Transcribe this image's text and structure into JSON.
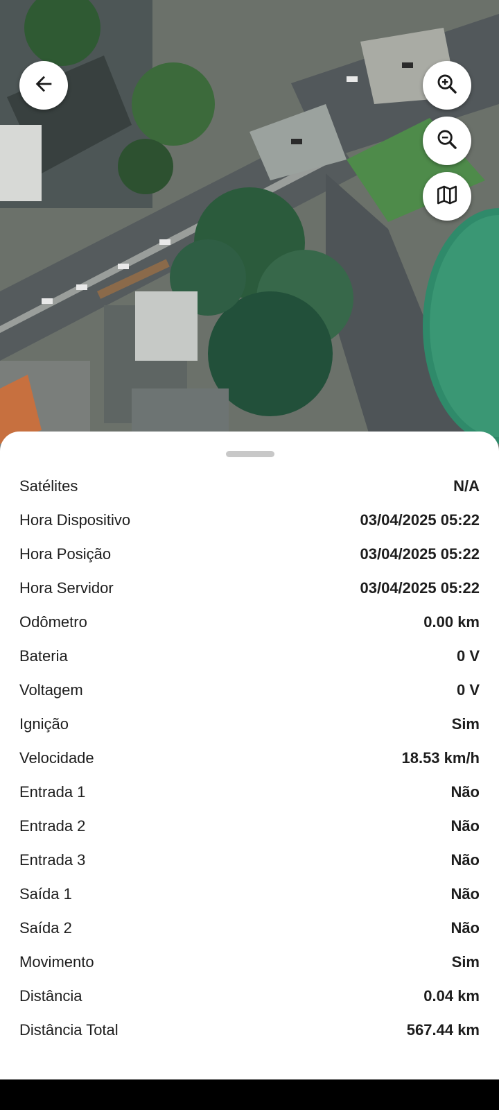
{
  "map": {
    "back_icon": "arrow-left-icon",
    "zoom_in_icon": "zoom-in-icon",
    "zoom_out_icon": "zoom-out-icon",
    "layers_icon": "map-icon"
  },
  "details": {
    "rows": [
      {
        "label": "Satélites",
        "value": "N/A"
      },
      {
        "label": "Hora Dispositivo",
        "value": "03/04/2025 05:22"
      },
      {
        "label": "Hora Posição",
        "value": "03/04/2025 05:22"
      },
      {
        "label": "Hora Servidor",
        "value": "03/04/2025 05:22"
      },
      {
        "label": "Odômetro",
        "value": "0.00 km"
      },
      {
        "label": "Bateria",
        "value": "0 V"
      },
      {
        "label": "Voltagem",
        "value": "0 V"
      },
      {
        "label": "Ignição",
        "value": "Sim"
      },
      {
        "label": "Velocidade",
        "value": "18.53 km/h"
      },
      {
        "label": "Entrada 1",
        "value": "Não"
      },
      {
        "label": "Entrada 2",
        "value": "Não"
      },
      {
        "label": "Entrada 3",
        "value": "Não"
      },
      {
        "label": "Saída 1",
        "value": "Não"
      },
      {
        "label": "Saída 2",
        "value": "Não"
      },
      {
        "label": "Movimento",
        "value": "Sim"
      },
      {
        "label": "Distância",
        "value": "0.04 km"
      },
      {
        "label": "Distância Total",
        "value": "567.44 km"
      }
    ]
  }
}
